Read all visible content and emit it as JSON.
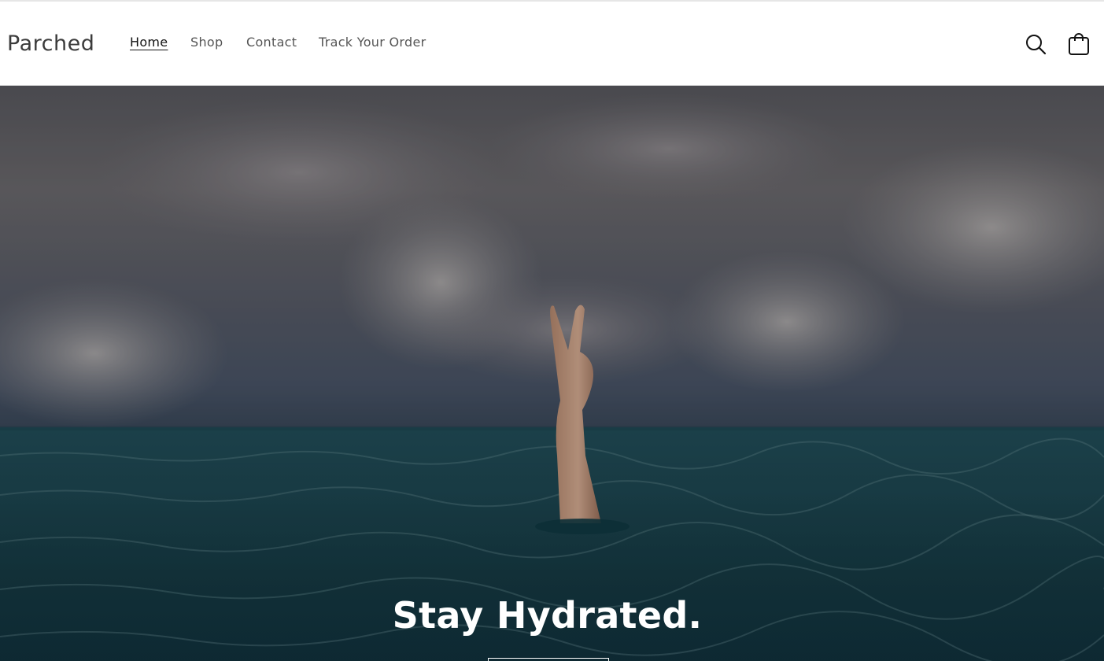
{
  "brand": {
    "name": "Parched"
  },
  "nav": {
    "items": [
      {
        "label": "Home",
        "active": true
      },
      {
        "label": "Shop",
        "active": false
      },
      {
        "label": "Contact",
        "active": false
      },
      {
        "label": "Track Your Order",
        "active": false
      }
    ]
  },
  "header_icons": {
    "search": "search-icon",
    "cart": "cart-icon"
  },
  "hero": {
    "heading": "Stay Hydrated."
  },
  "colors": {
    "text": "#121212",
    "nav_text": "#555555",
    "hero_heading": "#ffffff",
    "background": "#ffffff"
  }
}
